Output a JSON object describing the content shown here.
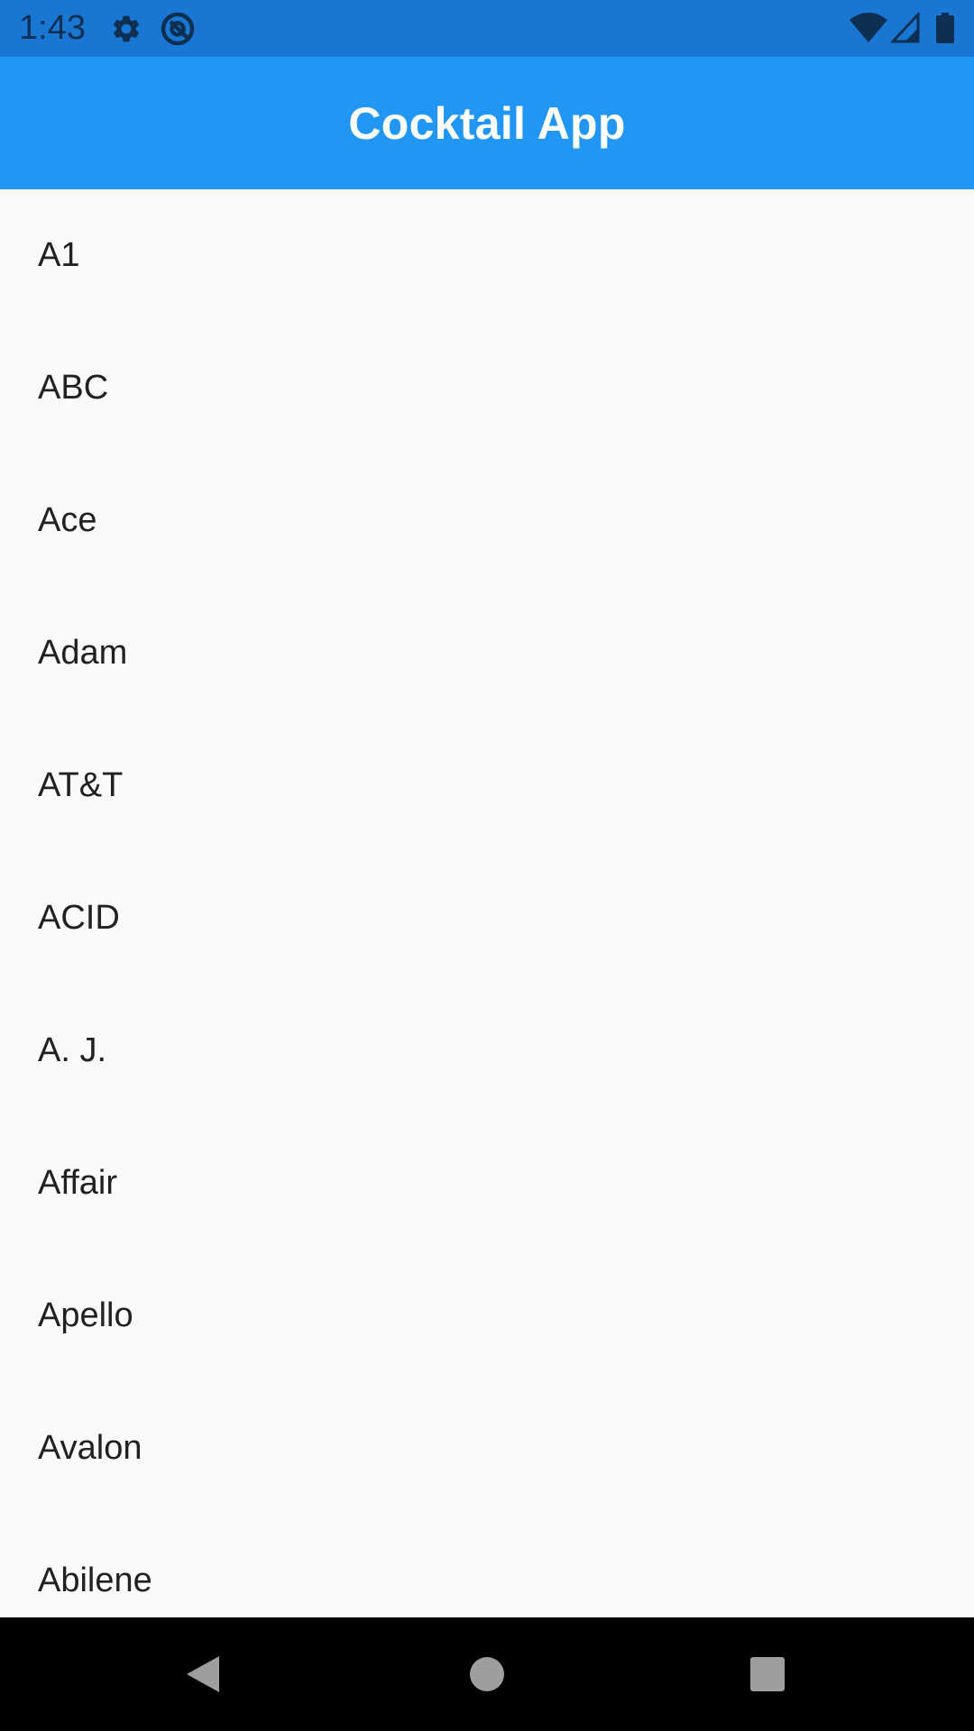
{
  "status_bar": {
    "time": "1:43",
    "icons": [
      "gear-icon",
      "at-sign-icon",
      "wifi-icon",
      "signal-icon",
      "battery-icon"
    ],
    "background": "#1976d2"
  },
  "app_bar": {
    "title": "Cocktail App",
    "background": "#2196f3"
  },
  "cocktails": [
    {
      "name": "A1"
    },
    {
      "name": "ABC"
    },
    {
      "name": "Ace"
    },
    {
      "name": "Adam"
    },
    {
      "name": "AT&T"
    },
    {
      "name": "ACID"
    },
    {
      "name": "A. J."
    },
    {
      "name": "Affair"
    },
    {
      "name": "Apello"
    },
    {
      "name": "Avalon"
    },
    {
      "name": "Abilene"
    }
  ],
  "nav_bar": {
    "buttons": [
      "back-icon",
      "home-icon",
      "recents-icon"
    ]
  }
}
